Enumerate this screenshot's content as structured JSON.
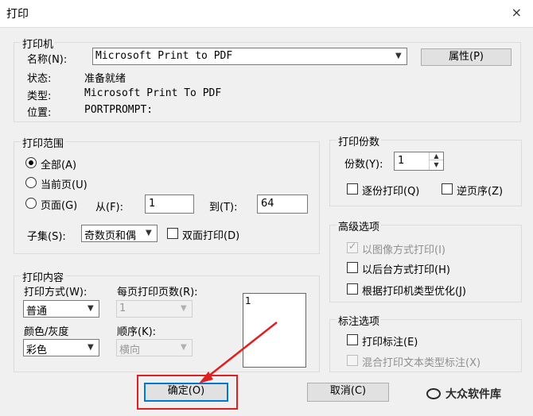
{
  "window": {
    "title": "打印",
    "close": "×"
  },
  "printer": {
    "legend": "打印机",
    "name_label": "名称(N):",
    "name_value": "Microsoft Print to PDF",
    "properties_button": "属性(P)",
    "status_label": "状态:",
    "status_value": "准备就绪",
    "type_label": "类型:",
    "type_value": "Microsoft Print To PDF",
    "location_label": "位置:",
    "location_value": "PORTPROMPT:"
  },
  "range": {
    "legend": "打印范围",
    "all": "全部(A)",
    "current": "当前页(U)",
    "pages": "页面(G)",
    "from_label": "从(F):",
    "from_value": "1",
    "to_label": "到(T):",
    "to_value": "64",
    "subset_label": "子集(S):",
    "subset_value": "奇数页和偶",
    "duplex": "双面打印(D)"
  },
  "copies": {
    "legend": "打印份数",
    "count_label": "份数(Y):",
    "count_value": "1",
    "collate": "逐份打印(Q)",
    "reverse": "逆页序(Z)"
  },
  "advanced": {
    "legend": "高级选项",
    "as_image": "以图像方式打印(I)",
    "background": "以后台方式打印(H)",
    "optimize": "根据打印机类型优化(J)"
  },
  "annotation": {
    "legend": "标注选项",
    "print_annotations": "打印标注(E)",
    "mixed": "混合打印文本类型标注(X)"
  },
  "content": {
    "legend": "打印内容",
    "mode_label": "打印方式(W):",
    "mode_value": "普通",
    "per_page_label": "每页打印页数(R):",
    "per_page_value": "1",
    "color_label": "颜色/灰度",
    "color_value": "彩色",
    "order_label": "顺序(K):",
    "order_value": "横向",
    "preview_page": "1"
  },
  "buttons": {
    "ok": "确定(O)",
    "cancel": "取消(C)"
  },
  "watermark": "大众软件库"
}
